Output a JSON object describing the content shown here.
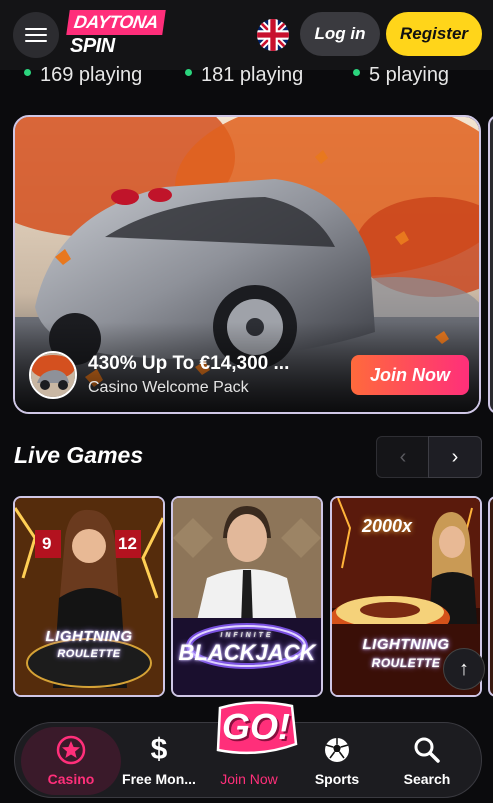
{
  "header": {
    "brand_top": "DAYTONA",
    "brand_bottom": "SPIN",
    "login_label": "Log in",
    "register_label": "Register",
    "language_icon": "uk-flag-icon"
  },
  "playing_counts": [
    {
      "text": "169 playing"
    },
    {
      "text": "181 playing"
    },
    {
      "text": "5 playing"
    }
  ],
  "promo": {
    "title": "430% Up To €14,300 ...",
    "subtitle": "Casino Welcome Pack",
    "cta_label": "Join Now"
  },
  "live_games": {
    "title": "Live Games",
    "games": [
      {
        "name_line1": "LIGHTNING",
        "name_line2": "ROULETTE",
        "numbers": [
          "9",
          "12"
        ]
      },
      {
        "name_line1": "INFINITE",
        "name_line2": "BLACKJACK"
      },
      {
        "name_line1": "LIGHTNING",
        "name_line2": "ROULETTE",
        "badge": "2000x"
      }
    ]
  },
  "bottom_nav": {
    "items": [
      {
        "label": "Casino",
        "icon": "star-icon",
        "active": true
      },
      {
        "label": "Free Mon...",
        "icon": "dollar-icon"
      },
      {
        "label": "Join Now",
        "icon": "go-badge-icon"
      },
      {
        "label": "Sports",
        "icon": "soccer-ball-icon"
      },
      {
        "label": "Search",
        "icon": "search-icon"
      }
    ],
    "go_text": "GO!"
  },
  "colors": {
    "accent_pink": "#ff2f7a",
    "register_yellow": "#ffd51a",
    "status_green": "#2bd47d"
  }
}
